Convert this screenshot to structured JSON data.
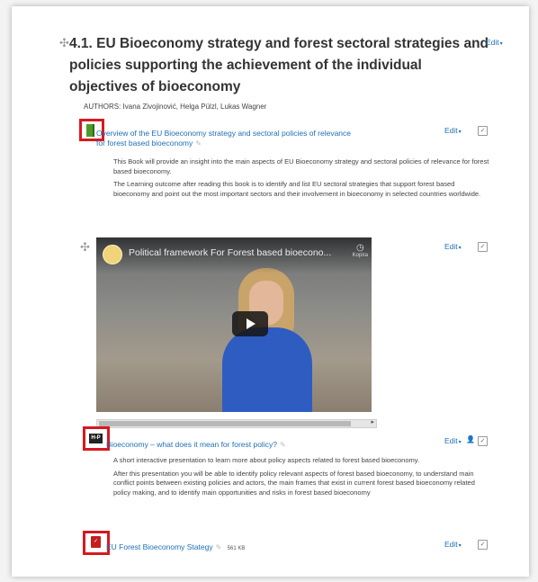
{
  "section": {
    "title": "4.1. EU Bioeconomy strategy and forest sectoral strategies and policies supporting the achievement of the individual objectives of bioeconomy",
    "edit_label": "Edit",
    "authors": "AUTHORS: Ivana Zivojinović, Helga Pülzl, Lukas Wagner"
  },
  "activities": [
    {
      "type": "book",
      "icon": "book-icon",
      "title": "Overview of the EU Bioeconomy strategy and sectoral policies of relevance for forest based bioeconomy",
      "edit_label": "Edit",
      "descriptions": [
        "This Book will provide an insight into the main aspects of EU Bioeconomy strategy and sectoral policies of relevance for forest based bioeconomy.",
        "The Learning outcome after reading this book is to identify and list EU sectoral strategies that support forest based bioeconomy and point out the most important sectors and their involvement in bioeconomy in selected countries worldwide."
      ]
    },
    {
      "type": "video",
      "video_title": "Political framework For Forest based bioecono...",
      "video_corner": "Kopira",
      "edit_label": "Edit"
    },
    {
      "type": "h5p",
      "icon": "h5p-icon",
      "icon_text": "H-P",
      "title": "Bioeconomy – what does it mean for forest policy?",
      "edit_label": "Edit",
      "descriptions": [
        "A short interactive presentation to learn more about policy aspects related to forest based bioeconomy.",
        "After this presentation you will be able to identify policy relevant aspects of forest based bioeconomy, to understand main conflict points between existing policies and actors, the main frames that exist in current forest based bioeconomy related policy making, and to identify main opportunities and risks in forest based bioeconomy"
      ]
    },
    {
      "type": "file",
      "icon": "pdf-icon",
      "title": "EU Forest Bioeconomy Stategy",
      "size": "561 KB",
      "edit_label": "Edit"
    }
  ],
  "colors": {
    "link": "#1f6fb5",
    "highlight": "#d71920",
    "h5p": "#222222",
    "pdf": "#c41e1e",
    "book": "#4d9a2b"
  }
}
